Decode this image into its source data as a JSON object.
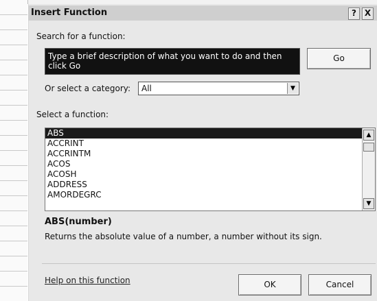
{
  "dialog": {
    "title": "Insert Function",
    "help_button": "?",
    "close_button": "X"
  },
  "search": {
    "label": "Search for a function:",
    "value": "Type a brief description of what you want to do and then click Go",
    "go_label": "Go"
  },
  "category": {
    "label": "Or select a category:",
    "value": "All"
  },
  "functions": {
    "label": "Select a function:",
    "items": [
      "ABS",
      "ACCRINT",
      "ACCRINTM",
      "ACOS",
      "ACOSH",
      "ADDRESS",
      "AMORDEGRC"
    ],
    "selected_index": 0
  },
  "detail": {
    "signature": "ABS(number)",
    "description": "Returns the absolute value of a number, a number without its sign."
  },
  "footer": {
    "help_link": "Help on this function",
    "ok_label": "OK",
    "cancel_label": "Cancel"
  },
  "icons": {
    "dropdown": "chevron-down-icon",
    "scroll_up": "arrow-up-icon",
    "scroll_down": "arrow-down-icon"
  }
}
